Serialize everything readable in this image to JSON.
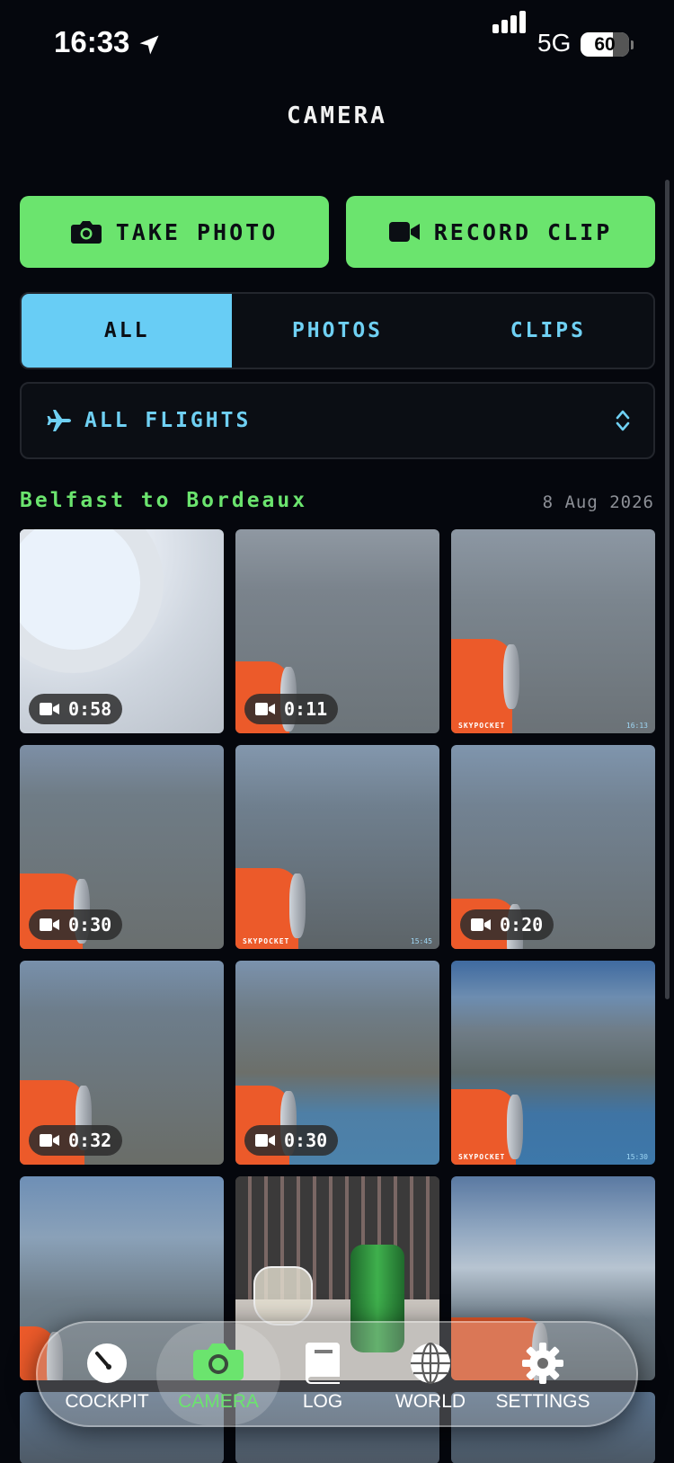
{
  "status_bar": {
    "time": "16:33",
    "network": "5G",
    "battery": "60"
  },
  "header": {
    "title": "CAMERA"
  },
  "actions": {
    "take_photo": "TAKE PHOTO",
    "record_clip": "RECORD CLIP"
  },
  "filter_tabs": [
    {
      "label": "ALL",
      "active": true
    },
    {
      "label": "PHOTOS",
      "active": false
    },
    {
      "label": "CLIPS",
      "active": false
    }
  ],
  "flight_filter": {
    "label": "ALL FLIGHTS"
  },
  "section": {
    "title": "Belfast to Bordeaux",
    "date": "8 Aug 2026"
  },
  "media": [
    {
      "kind": "clip",
      "duration": "0:58"
    },
    {
      "kind": "clip",
      "duration": "0:11"
    },
    {
      "kind": "photo",
      "watermark": "SKYPOCKET",
      "time": "16:13"
    },
    {
      "kind": "clip",
      "duration": "0:30"
    },
    {
      "kind": "photo",
      "watermark": "SKYPOCKET",
      "time": "15:45"
    },
    {
      "kind": "clip",
      "duration": "0:20"
    },
    {
      "kind": "clip",
      "duration": "0:32"
    },
    {
      "kind": "clip",
      "duration": "0:30"
    },
    {
      "kind": "photo",
      "watermark": "SKYPOCKET",
      "time": "15:30"
    }
  ],
  "tab_bar": [
    {
      "label": "COCKPIT",
      "icon": "gauge-icon",
      "active": false
    },
    {
      "label": "CAMERA",
      "icon": "camera-icon",
      "active": true
    },
    {
      "label": "LOG",
      "icon": "book-icon",
      "active": false
    },
    {
      "label": "WORLD",
      "icon": "globe-icon",
      "active": false
    },
    {
      "label": "SETTINGS",
      "icon": "gear-icon",
      "active": false
    }
  ],
  "colors": {
    "accent_green": "#6be46e",
    "accent_blue": "#68cdf5",
    "background": "#05070d"
  }
}
